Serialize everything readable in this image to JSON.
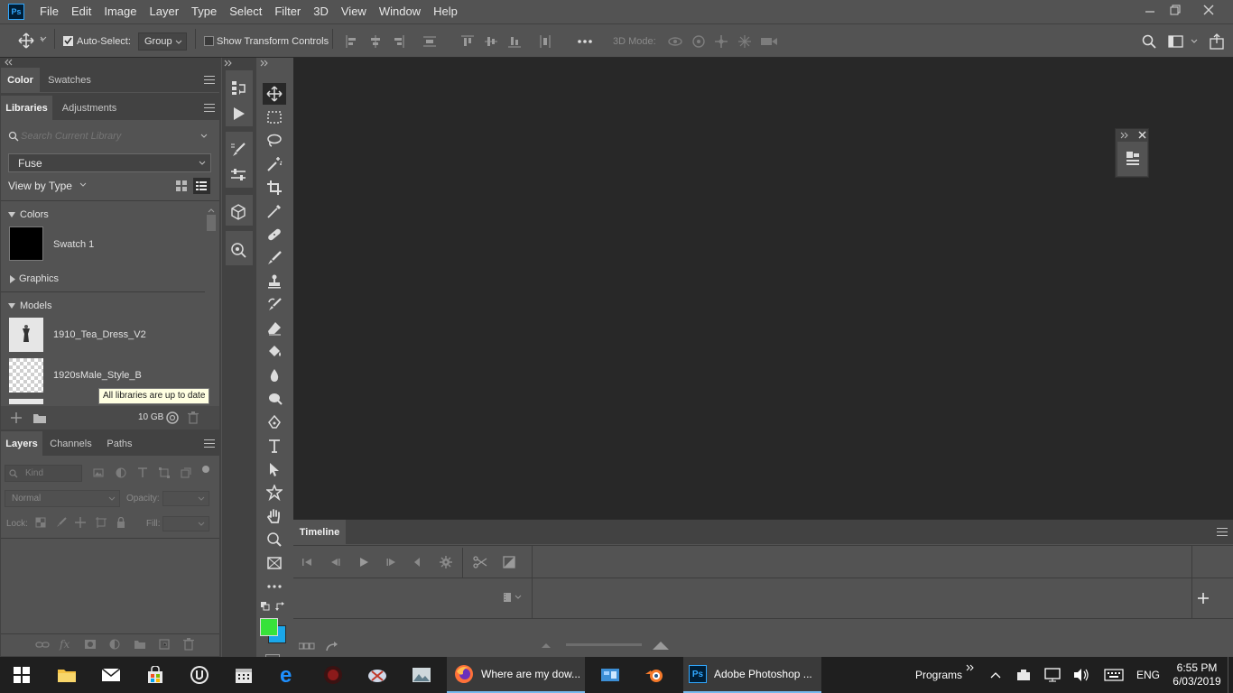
{
  "app": {
    "logo": "Ps"
  },
  "menubar": {
    "items": [
      "File",
      "Edit",
      "Image",
      "Layer",
      "Type",
      "Select",
      "Filter",
      "3D",
      "View",
      "Window",
      "Help"
    ]
  },
  "options": {
    "auto_select_label": "Auto-Select:",
    "auto_select_checked": true,
    "auto_select_value": "Group",
    "show_transform_label": "Show Transform Controls",
    "show_transform_checked": false,
    "mode_3d_label": "3D Mode:"
  },
  "color_panel": {
    "tabs": [
      "Color",
      "Swatches"
    ]
  },
  "libraries_panel": {
    "tabs": [
      "Libraries",
      "Adjustments"
    ],
    "search_placeholder": "Search Current Library",
    "library_name": "Fuse",
    "view_by_label": "View by Type",
    "sections": [
      {
        "name": "Colors",
        "expanded": true,
        "items": [
          {
            "label": "Swatch 1",
            "color": "#000000"
          }
        ]
      },
      {
        "name": "Graphics",
        "expanded": false,
        "items": []
      },
      {
        "name": "Models",
        "expanded": true,
        "items": [
          {
            "label": "1910_Tea_Dress_V2"
          },
          {
            "label": "1920sMale_Style_B"
          }
        ]
      }
    ],
    "tooltip": "All libraries are up to date",
    "storage": "10 GB"
  },
  "layers_panel": {
    "tabs": [
      "Layers",
      "Channels",
      "Paths"
    ],
    "filter_placeholder": "Kind",
    "blend_mode": "Normal",
    "opacity_label": "Opacity:",
    "lock_label": "Lock:",
    "fill_label": "Fill:"
  },
  "colors": {
    "foreground": "#37e23a",
    "background": "#1aa7ea"
  },
  "timeline": {
    "title": "Timeline"
  },
  "taskbar": {
    "firefox_label": "Where are my dow...",
    "photoshop_label": "Adobe Photoshop ...",
    "programs_label": "Programs",
    "language": "ENG",
    "time": "6:55 PM",
    "date": "6/03/2019"
  }
}
